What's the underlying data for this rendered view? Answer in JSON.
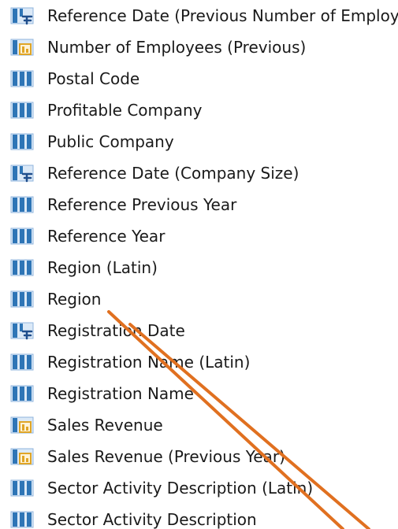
{
  "fields": [
    {
      "label": "Reference Date (Previous Number of Employe",
      "icon": "date-hierarchy-icon"
    },
    {
      "label": "Number of Employees (Previous)",
      "icon": "measure-icon"
    },
    {
      "label": "Postal Code",
      "icon": "column-icon"
    },
    {
      "label": "Profitable Company",
      "icon": "column-icon"
    },
    {
      "label": "Public Company",
      "icon": "column-icon"
    },
    {
      "label": "Reference Date (Company Size)",
      "icon": "date-hierarchy-icon"
    },
    {
      "label": "Reference Previous Year",
      "icon": "column-icon"
    },
    {
      "label": "Reference Year",
      "icon": "column-icon"
    },
    {
      "label": "Region (Latin)",
      "icon": "column-icon"
    },
    {
      "label": "Region",
      "icon": "column-icon"
    },
    {
      "label": "Registration Date",
      "icon": "date-hierarchy-icon"
    },
    {
      "label": "Registration Name (Latin)",
      "icon": "column-icon"
    },
    {
      "label": "Registration Name",
      "icon": "column-icon"
    },
    {
      "label": "Sales Revenue",
      "icon": "measure-icon"
    },
    {
      "label": "Sales Revenue (Previous Year)",
      "icon": "measure-icon"
    },
    {
      "label": "Sector Activity Description (Latin)",
      "icon": "column-icon"
    },
    {
      "label": "Sector Activity Description",
      "icon": "column-icon"
    }
  ],
  "colors": {
    "column_icon": "#2e75b6",
    "measure_icon": "#e0a526",
    "annotation_line": "#e07020",
    "text": "#1a1a1a"
  }
}
